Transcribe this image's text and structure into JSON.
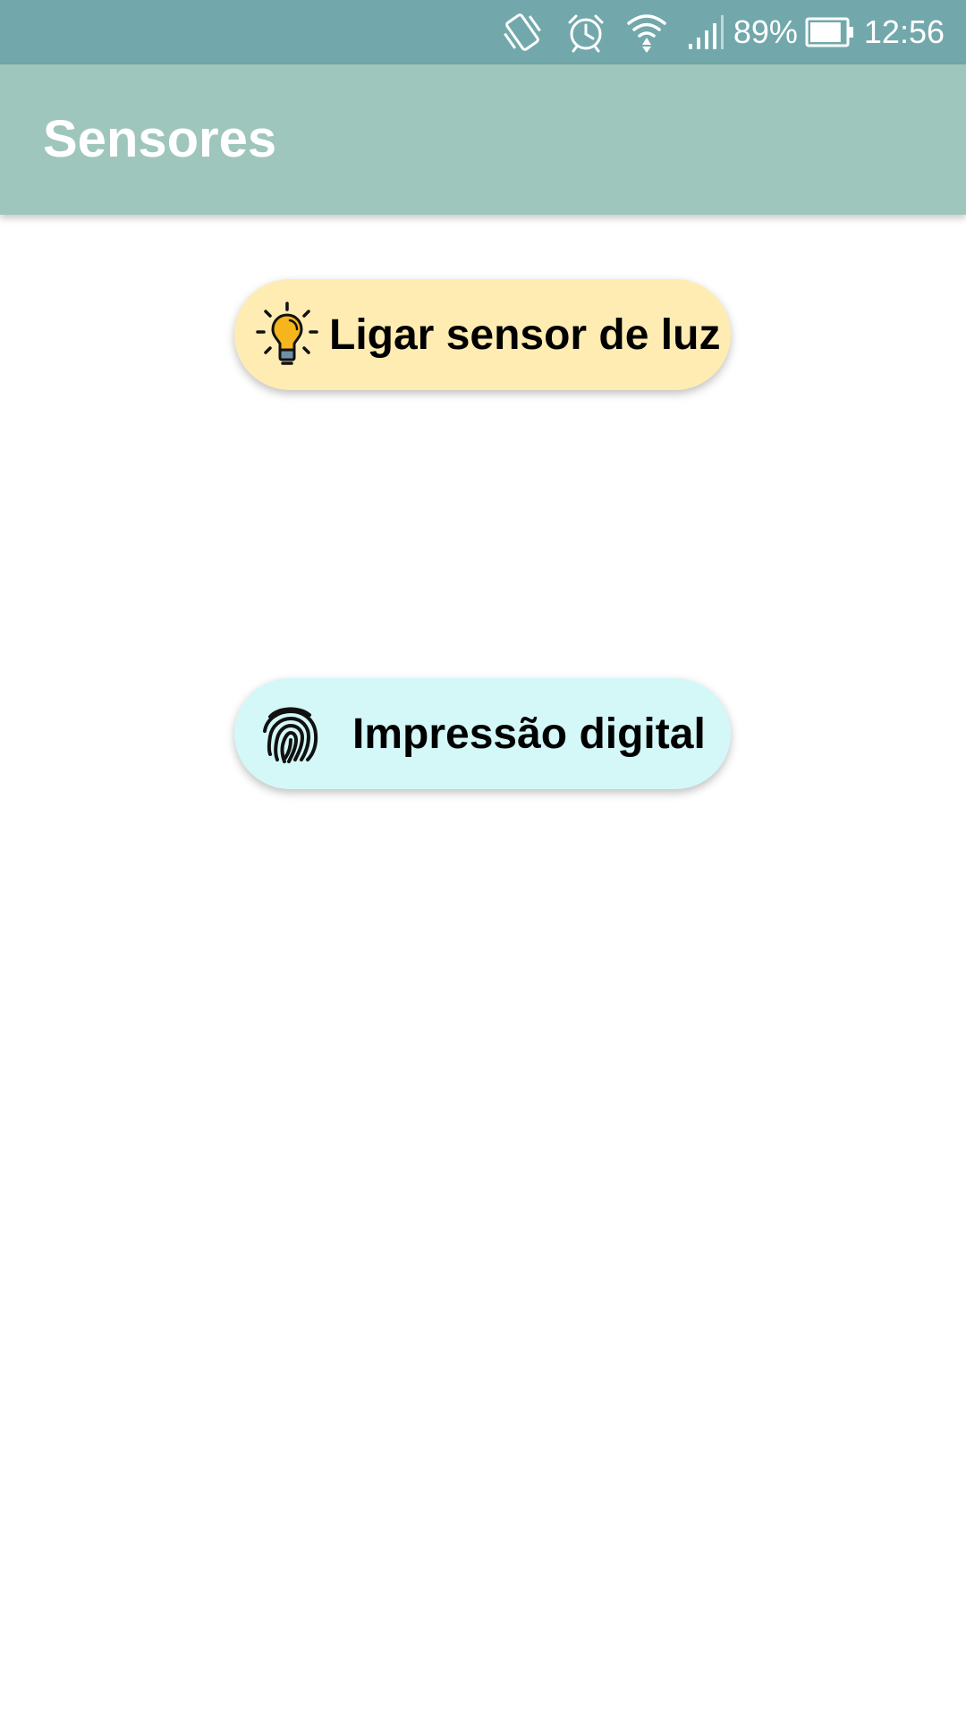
{
  "status_bar": {
    "battery_percent": "89%",
    "battery_level": 0.89,
    "time": "12:56",
    "icons": [
      "vibrate-icon",
      "alarm-icon",
      "wifi-icon",
      "signal-icon",
      "battery-icon"
    ],
    "background_color": "#72a8ab"
  },
  "app_bar": {
    "title": "Sensores",
    "background_color": "#9fc6bc"
  },
  "buttons": {
    "light_sensor": {
      "label": "Ligar sensor de luz",
      "icon": "lightbulb-icon",
      "background_color": "#feecb3"
    },
    "fingerprint": {
      "label": "Impressão digital",
      "icon": "fingerprint-icon",
      "background_color": "#d4f8f8"
    }
  }
}
